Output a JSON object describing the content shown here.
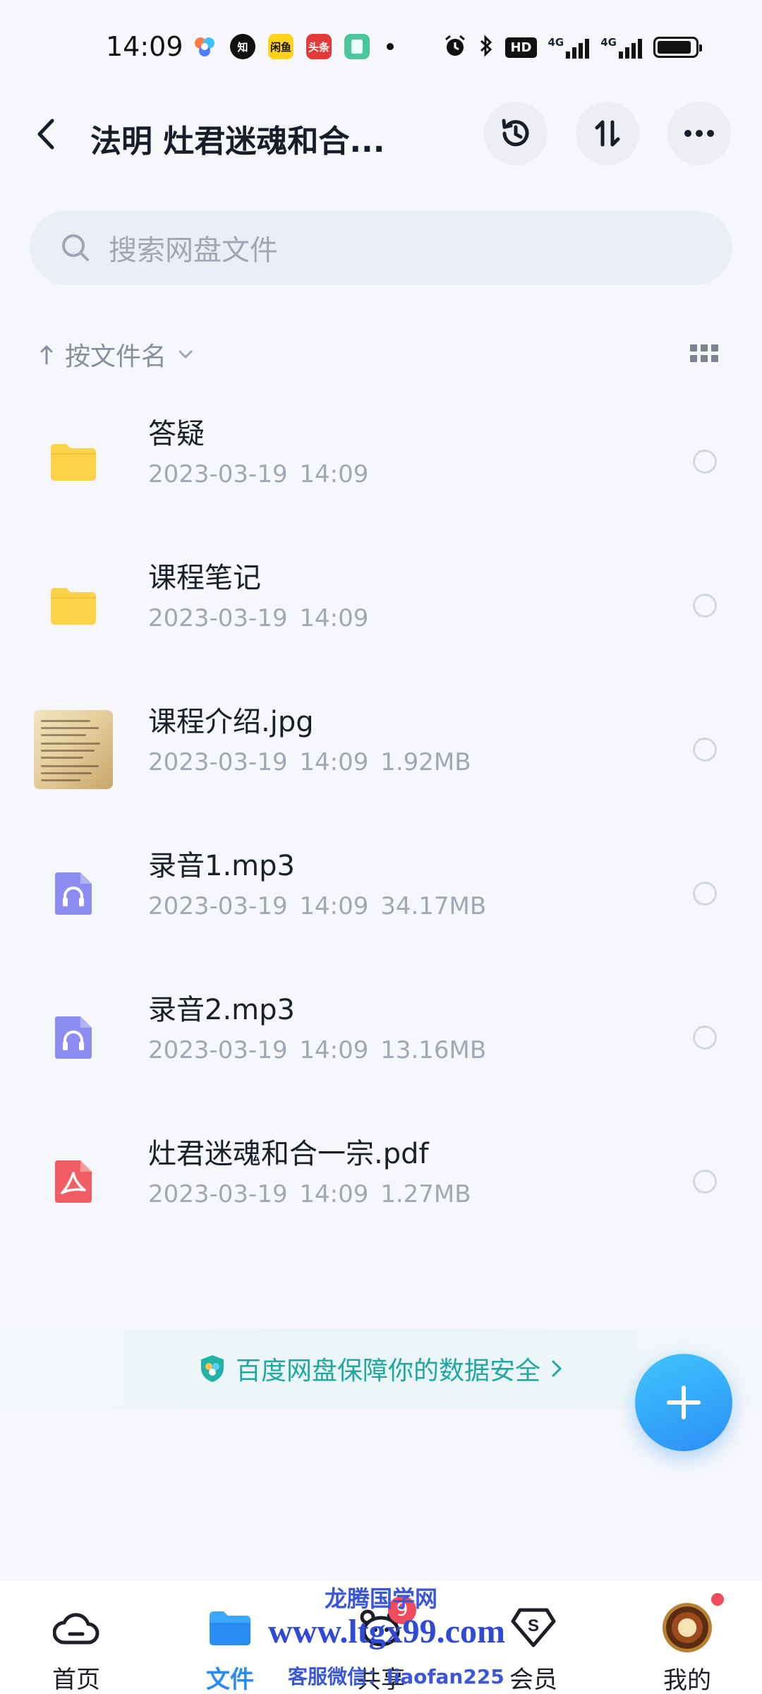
{
  "status_bar": {
    "time": "14:09",
    "app_icons": [
      {
        "name": "baidu-netdisk-icon",
        "text": "",
        "color": "#4fb0ff"
      },
      {
        "name": "zhihu-icon",
        "text": "知",
        "color": "#111111"
      },
      {
        "name": "xianyu-icon",
        "text": "闲鱼",
        "color": "#ffd21e"
      },
      {
        "name": "toutiao-icon",
        "text": "头条",
        "color": "#e33a3a"
      },
      {
        "name": "notes-icon",
        "text": "",
        "color": "#4bc79c"
      }
    ],
    "network": "HD",
    "signal1": "4G",
    "signal2": "4G",
    "battery_level": 0.9
  },
  "header": {
    "title": "法明 灶君迷魂和合...",
    "back_icon": "back-arrow-icon",
    "history_icon": "history-icon",
    "sort_icon": "sort-icon",
    "more_icon": "more-icon"
  },
  "search": {
    "placeholder": "搜索网盘文件"
  },
  "sort": {
    "label": "按文件名"
  },
  "files": [
    {
      "name": "答疑",
      "date": "2023-03-19",
      "time": "14:09",
      "size": "",
      "type": "folder"
    },
    {
      "name": "课程笔记",
      "date": "2023-03-19",
      "time": "14:09",
      "size": "",
      "type": "folder"
    },
    {
      "name": "课程介绍.jpg",
      "date": "2023-03-19",
      "time": "14:09",
      "size": "1.92MB",
      "type": "image"
    },
    {
      "name": "录音1.mp3",
      "date": "2023-03-19",
      "time": "14:09",
      "size": "34.17MB",
      "type": "audio"
    },
    {
      "name": "录音2.mp3",
      "date": "2023-03-19",
      "time": "14:09",
      "size": "13.16MB",
      "type": "audio"
    },
    {
      "name": "灶君迷魂和合一宗.pdf",
      "date": "2023-03-19",
      "time": "14:09",
      "size": "1.27MB",
      "type": "pdf"
    }
  ],
  "security_banner": {
    "text": "百度网盘保障你的数据安全"
  },
  "colors": {
    "accent": "#2a8cf4",
    "folder": "#fcd24a",
    "audio": "#8d8cf2",
    "pdf": "#f25d64",
    "security": "#20a8a0"
  },
  "bottom_nav": {
    "items": [
      {
        "label": "首页",
        "icon": "home-cloud-icon",
        "active": false
      },
      {
        "label": "文件",
        "icon": "folder-icon",
        "active": true
      },
      {
        "label": "共享",
        "icon": "share-bear-icon",
        "active": false,
        "badge": "9"
      },
      {
        "label": "会员",
        "icon": "vip-diamond-icon",
        "active": false
      },
      {
        "label": "我的",
        "icon": "avatar",
        "active": false,
        "dot": true
      }
    ]
  },
  "watermark": {
    "line1": "龙腾国学网",
    "line2": "www.ltgx99.com",
    "line3": "客服微信：liaofan225"
  }
}
